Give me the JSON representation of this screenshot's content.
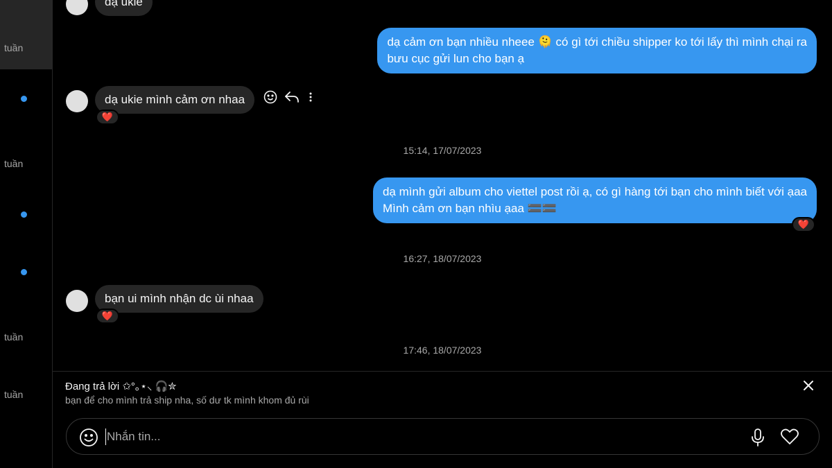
{
  "sidebar": {
    "times": [
      "tuần",
      "tuần",
      "tuần",
      "tuần"
    ],
    "accent": "#3797f0"
  },
  "messages": {
    "m1_text": "dạ ukie",
    "m2_line1": "dạ cảm ơn bạn nhiều nheee 🫠 có gì tới chiều shipper ko tới lấy thì mình chại ra",
    "m2_line2": "bưu cục gửi lun cho bạn ạ",
    "m3_text": "dạ ukie mình cảm ơn nhaa",
    "ts1": "15:14, 17/07/2023",
    "m4_line1": "dạ mình gửi album cho viettel post rồi ạ, có gì hàng tới bạn cho mình biết với ạaa",
    "m4_line2": "Mình cảm ơn bạn nhìu ạaa 🟰🟰",
    "ts2": "16:27, 18/07/2023",
    "m5_text": "bạn ui mình nhận dc ùi nhaa",
    "ts3": "17:46, 18/07/2023",
    "reaction_emoji": "❤️"
  },
  "reply": {
    "title": "Đang trả lời ✩°｡⋆⸜ 🎧✮",
    "text": "bạn để cho mình trả ship nha, số dư tk mình khom đủ rùi"
  },
  "composer": {
    "placeholder": "Nhắn tin..."
  },
  "colors": {
    "outgoing_bubble": "#3797f0",
    "incoming_bubble": "#262626",
    "background": "#000000"
  }
}
